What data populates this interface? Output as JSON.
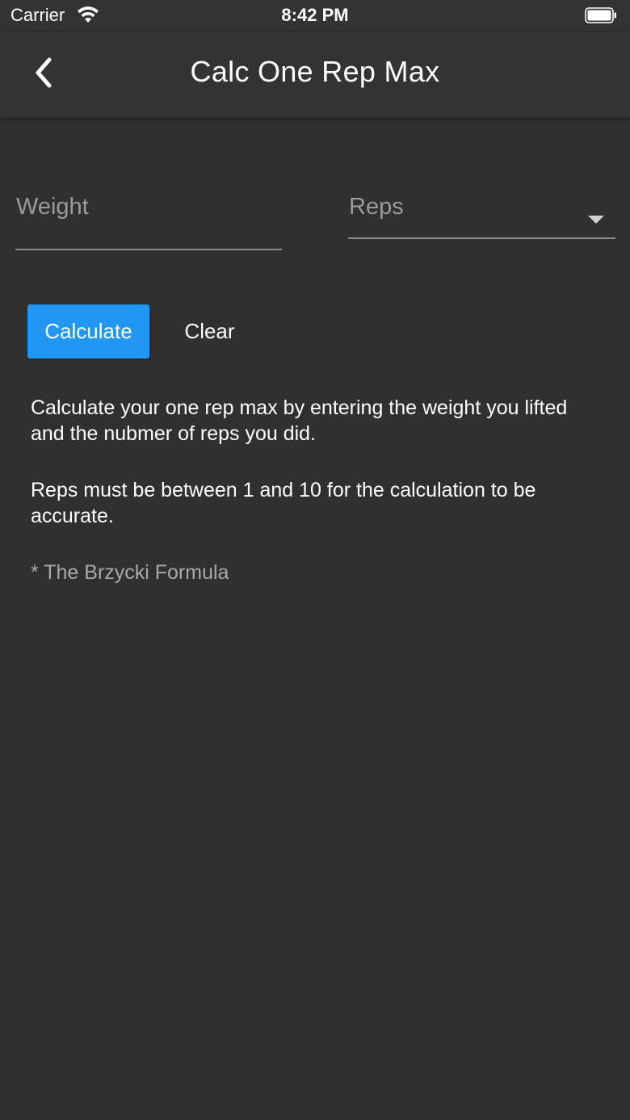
{
  "status_bar": {
    "carrier": "Carrier",
    "time": "8:42 PM"
  },
  "app_bar": {
    "title": "Calc One Rep Max",
    "back_icon": "chevron-left-icon"
  },
  "form": {
    "weight_placeholder": "Weight",
    "weight_value": "",
    "reps_hint": "Reps",
    "reps_icon": "dropdown-arrow-icon"
  },
  "buttons": {
    "calculate_label": "Calculate",
    "clear_label": "Clear"
  },
  "info": {
    "paragraph_1": "Calculate your one rep max by entering the weight you lifted and the nubmer of reps you did.",
    "paragraph_2": "Reps must be between 1 and 10 for the calculation to be accurate.",
    "footnote": "* The Brzycki Formula"
  },
  "colors": {
    "background": "#303030",
    "app_bar": "#333333",
    "accent": "#2196f3",
    "hint_text": "#9a9a9a"
  }
}
